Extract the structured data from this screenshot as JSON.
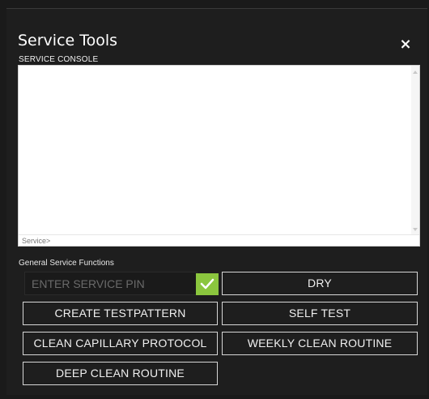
{
  "dialog": {
    "title": "Service Tools",
    "close_icon": "close-icon"
  },
  "console": {
    "label": "SERVICE CONSOLE",
    "prompt": "Service>"
  },
  "functions": {
    "section_label": "General Service Functions",
    "pin_placeholder": "ENTER SERVICE PIN",
    "pin_confirm_icon": "checkmark-icon",
    "buttons": {
      "dry": "DRY",
      "create_testpattern": "CREATE TESTPATTERN",
      "self_test": "SELF TEST",
      "clean_capillary_protocol": "CLEAN CAPILLARY PROTOCOL",
      "weekly_clean_routine": "WEEKLY CLEAN ROUTINE",
      "deep_clean_routine": "DEEP CLEAN ROUTINE"
    }
  },
  "colors": {
    "dialog_background": "#1e1e1e",
    "confirm_green": "#8bc63e",
    "console_background": "#ffffff"
  }
}
